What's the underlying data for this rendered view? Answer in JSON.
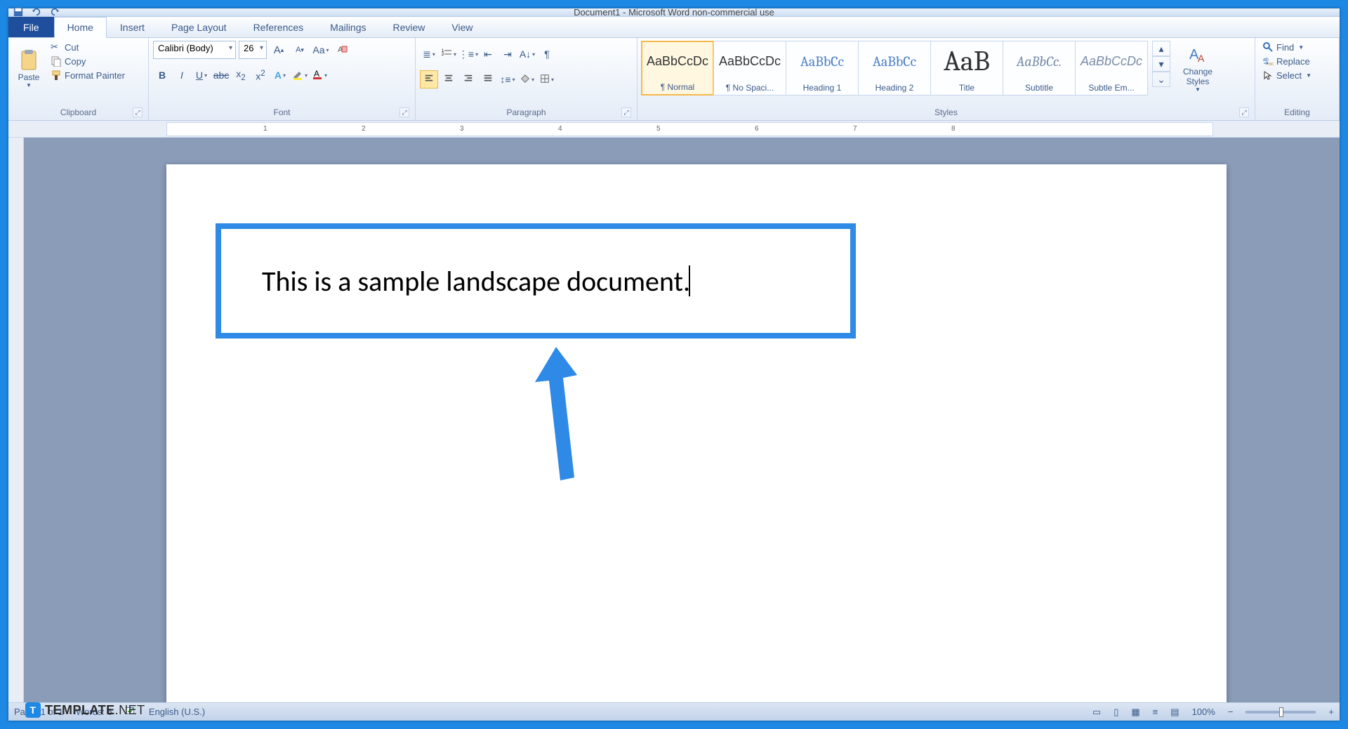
{
  "window": {
    "title": "Document1 - Microsoft Word non-commercial use"
  },
  "tabs": {
    "file": "File",
    "items": [
      "Home",
      "Insert",
      "Page Layout",
      "References",
      "Mailings",
      "Review",
      "View"
    ],
    "active_index": 0
  },
  "clipboard": {
    "paste": "Paste",
    "cut": "Cut",
    "copy": "Copy",
    "format_painter": "Format Painter",
    "group_label": "Clipboard"
  },
  "font": {
    "name": "Calibri (Body)",
    "size": "26",
    "group_label": "Font"
  },
  "paragraph": {
    "group_label": "Paragraph"
  },
  "styles": {
    "group_label": "Styles",
    "change_styles": "Change\nStyles",
    "items": [
      {
        "preview": "AaBbCcDc",
        "label": "¶ Normal"
      },
      {
        "preview": "AaBbCcDc",
        "label": "¶ No Spaci..."
      },
      {
        "preview": "AaBbCc",
        "label": "Heading 1"
      },
      {
        "preview": "AaBbCc",
        "label": "Heading 2"
      },
      {
        "preview": "AaB",
        "label": "Title"
      },
      {
        "preview": "AaBbCc.",
        "label": "Subtitle"
      },
      {
        "preview": "AaBbCcDc",
        "label": "Subtle Em..."
      }
    ],
    "active_index": 0
  },
  "editing": {
    "find": "Find",
    "replace": "Replace",
    "select": "Select",
    "group_label": "Editing"
  },
  "document": {
    "body_text": "This is a sample landscape document."
  },
  "statusbar": {
    "page": "Page: 1 of 1",
    "words": "Words: 6",
    "language": "English (U.S.)",
    "zoom": "100%"
  },
  "watermark": {
    "brand": "TEMPLATE",
    "suffix": ".NET"
  }
}
